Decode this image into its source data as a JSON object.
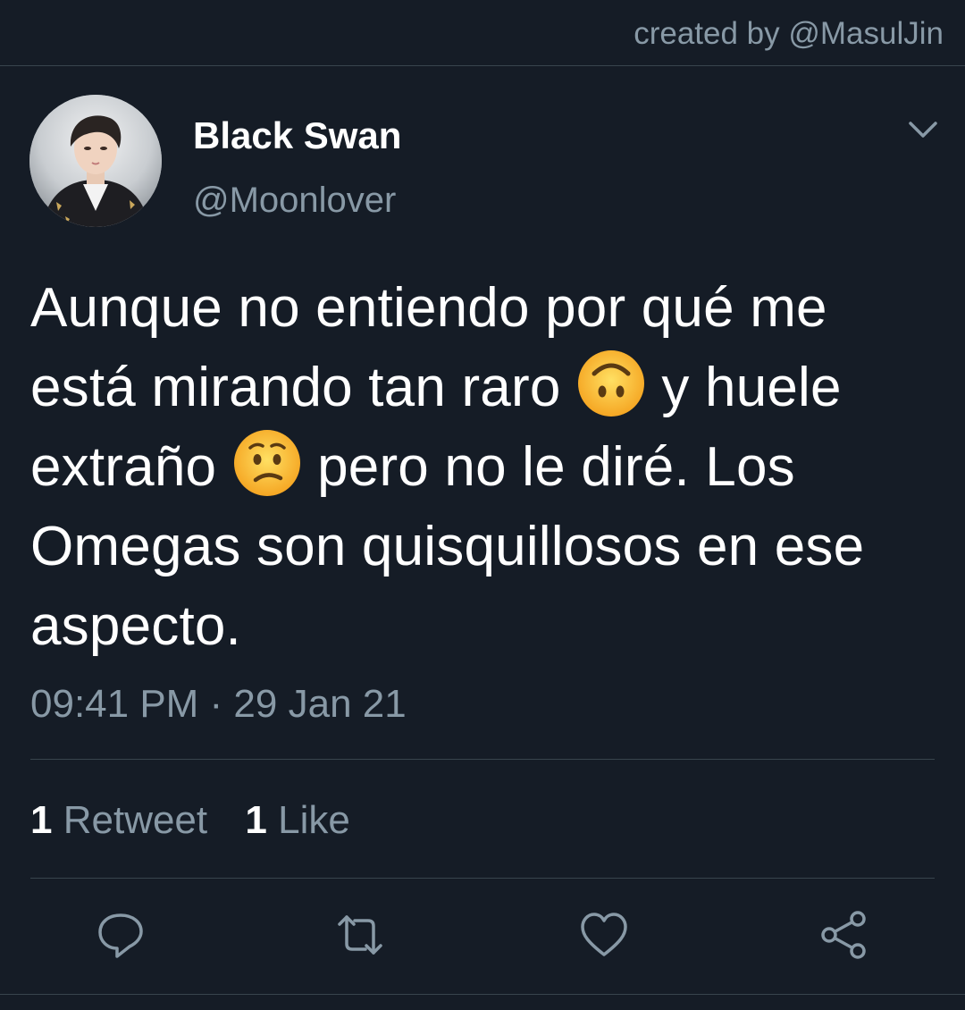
{
  "watermark": "created by @MasulJin",
  "tweet": {
    "author": {
      "display_name": "Black Swan",
      "handle": "@Moonlover"
    },
    "text_parts": {
      "p1": "Aunque no entiendo por qué me está mirando tan raro",
      "emoji1": "upside-down-face-emoji",
      "p2": "y huele extraño",
      "emoji2": "confused-face-emoji",
      "p3": "pero no le diré. Los Omegas son quisquillosos en ese aspecto."
    },
    "timestamp": "09:41 PM · 29 Jan 21",
    "stats": {
      "retweets_count": "1",
      "retweets_label": "Retweet",
      "likes_count": "1",
      "likes_label": "Like"
    }
  },
  "actions": {
    "reply_icon": "reply-icon",
    "retweet_icon": "retweet-icon",
    "like_icon": "heart-icon",
    "share_icon": "share-icon"
  },
  "colors": {
    "background": "#151c26",
    "text_primary": "#ffffff",
    "text_secondary": "#8899a6",
    "divider": "#38444d"
  }
}
